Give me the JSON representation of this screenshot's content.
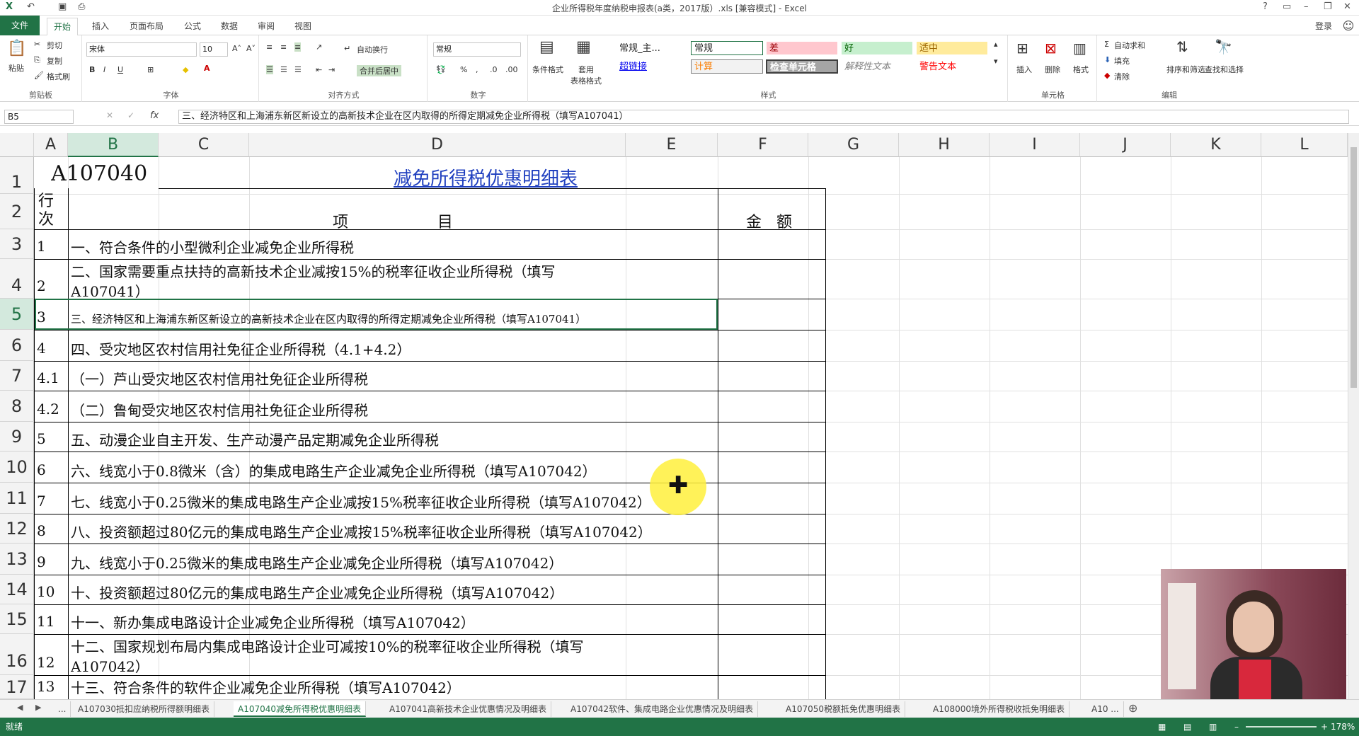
{
  "titlebar": {
    "doc_title": "企业所得税年度纳税申报表(a类，2017版）.xls  [兼容模式] - Excel",
    "help": "?",
    "login": "登录"
  },
  "ribbon_tabs": [
    "文件",
    "开始",
    "插入",
    "页面布局",
    "公式",
    "数据",
    "审阅",
    "视图"
  ],
  "clipboard": {
    "paste": "粘贴",
    "cut": "剪切",
    "copy": "复制",
    "format_painter": "格式刷",
    "label": "剪贴板"
  },
  "font": {
    "name": "宋体",
    "size": "10",
    "label": "字体",
    "bold": "B",
    "italic": "I",
    "underline": "U"
  },
  "alignment": {
    "wrap": "自动换行",
    "merge": "合并后居中",
    "label": "对齐方式"
  },
  "number": {
    "format": "常规",
    "label": "数字",
    "percent": "%"
  },
  "styles_group": {
    "cond_format": "条件格式",
    "table_format": "套用\n表格格式",
    "label": "样式",
    "items": [
      {
        "text": "常规_主...",
        "bg": "#ffffff",
        "fg": "#222222"
      },
      {
        "text": "常规",
        "bg": "#ffffff",
        "fg": "#222222"
      },
      {
        "text": "差",
        "bg": "#ffc7ce",
        "fg": "#9c0006"
      },
      {
        "text": "好",
        "bg": "#c6efce",
        "fg": "#006100"
      },
      {
        "text": "适中",
        "bg": "#ffeb9c",
        "fg": "#9c6500"
      },
      {
        "text": "超链接",
        "bg": "#ffffff",
        "fg": "#0000ee"
      },
      {
        "text": "计算",
        "bg": "#f2f2f2",
        "fg": "#fa7d00"
      },
      {
        "text": "检查单元格",
        "bg": "#a5a5a5",
        "fg": "#ffffff"
      },
      {
        "text": "解释性文本",
        "bg": "#ffffff",
        "fg": "#7f7f7f"
      },
      {
        "text": "警告文本",
        "bg": "#ffffff",
        "fg": "#ff0000"
      }
    ]
  },
  "cells_group": {
    "insert": "插入",
    "delete": "删除",
    "format": "格式",
    "label": "单元格"
  },
  "editing": {
    "autosum": "自动求和",
    "fill": "填充",
    "clear": "清除",
    "sort": "排序和筛选",
    "find": "查找和选择",
    "label": "编辑"
  },
  "formula_bar": {
    "name_box": "B5",
    "fx": "fx",
    "content": "三、经济特区和上海浦东新区新设立的高新技术企业在区内取得的所得定期减免企业所得税（填写A107041）"
  },
  "columns": [
    "A",
    "B",
    "C",
    "D",
    "E",
    "F",
    "G",
    "H",
    "I",
    "J",
    "K",
    "L"
  ],
  "sheet": {
    "code": "A107040",
    "title": "减免所得税优惠明细表",
    "hdr_row": "行次",
    "hdr_item": "项                  目",
    "hdr_amount": "金   额",
    "rows": [
      {
        "r": "3",
        "no": "1",
        "text": "一、符合条件的小型微利企业减免企业所得税"
      },
      {
        "r": "4",
        "no": "2",
        "text": "二、国家需要重点扶持的高新技术企业减按15%的税率征收企业所得税（填写",
        "text2": "A107041）"
      },
      {
        "r": "5",
        "no": "3",
        "text": "三、经济特区和上海浦东新区新设立的高新技术企业在区内取得的所得定期减免企业所得税（填写A107041）"
      },
      {
        "r": "6",
        "no": "4",
        "text": "四、受灾地区农村信用社免征企业所得税（4.1+4.2）"
      },
      {
        "r": "7",
        "no": "4.1",
        "text": "（一）芦山受灾地区农村信用社免征企业所得税"
      },
      {
        "r": "8",
        "no": "4.2",
        "text": "（二）鲁甸受灾地区农村信用社免征企业所得税"
      },
      {
        "r": "9",
        "no": "5",
        "text": "五、动漫企业自主开发、生产动漫产品定期减免企业所得税"
      },
      {
        "r": "10",
        "no": "6",
        "text": "六、线宽小于0.8微米（含）的集成电路生产企业减免企业所得税（填写A107042）"
      },
      {
        "r": "11",
        "no": "7",
        "text": "七、线宽小于0.25微米的集成电路生产企业减按15%税率征收企业所得税（填写A107042）"
      },
      {
        "r": "12",
        "no": "8",
        "text": "八、投资额超过80亿元的集成电路生产企业减按15%税率征收企业所得税（填写A107042）"
      },
      {
        "r": "13",
        "no": "9",
        "text": "九、线宽小于0.25微米的集成电路生产企业减免企业所得税（填写A107042）"
      },
      {
        "r": "14",
        "no": "10",
        "text": "十、投资额超过80亿元的集成电路生产企业减免企业所得税（填写A107042）"
      },
      {
        "r": "15",
        "no": "11",
        "text": "十一、新办集成电路设计企业减免企业所得税（填写A107042）"
      },
      {
        "r": "16",
        "no": "12",
        "text": "十二、国家规划布局内集成电路设计企业可减按10%的税率征收企业所得税（填写",
        "text2": "A107042）"
      },
      {
        "r": "17",
        "no": "13",
        "text": "十三、符合条件的软件企业减免企业所得税（填写A107042）"
      }
    ]
  },
  "row_numbers": [
    "1",
    "2"
  ],
  "sheet_tabs": [
    "...",
    "A107030抵扣应纳税所得额明细表",
    "A107040减免所得税优惠明细表",
    "A107041高新技术企业优惠情况及明细表",
    "A107042软件、集成电路企业优惠情况及明细表",
    "A107050税额抵免优惠明细表",
    "A108000境外所得税收抵免明细表",
    "A10 ..."
  ],
  "status": {
    "ready": "就绪",
    "zoom": "178%"
  }
}
